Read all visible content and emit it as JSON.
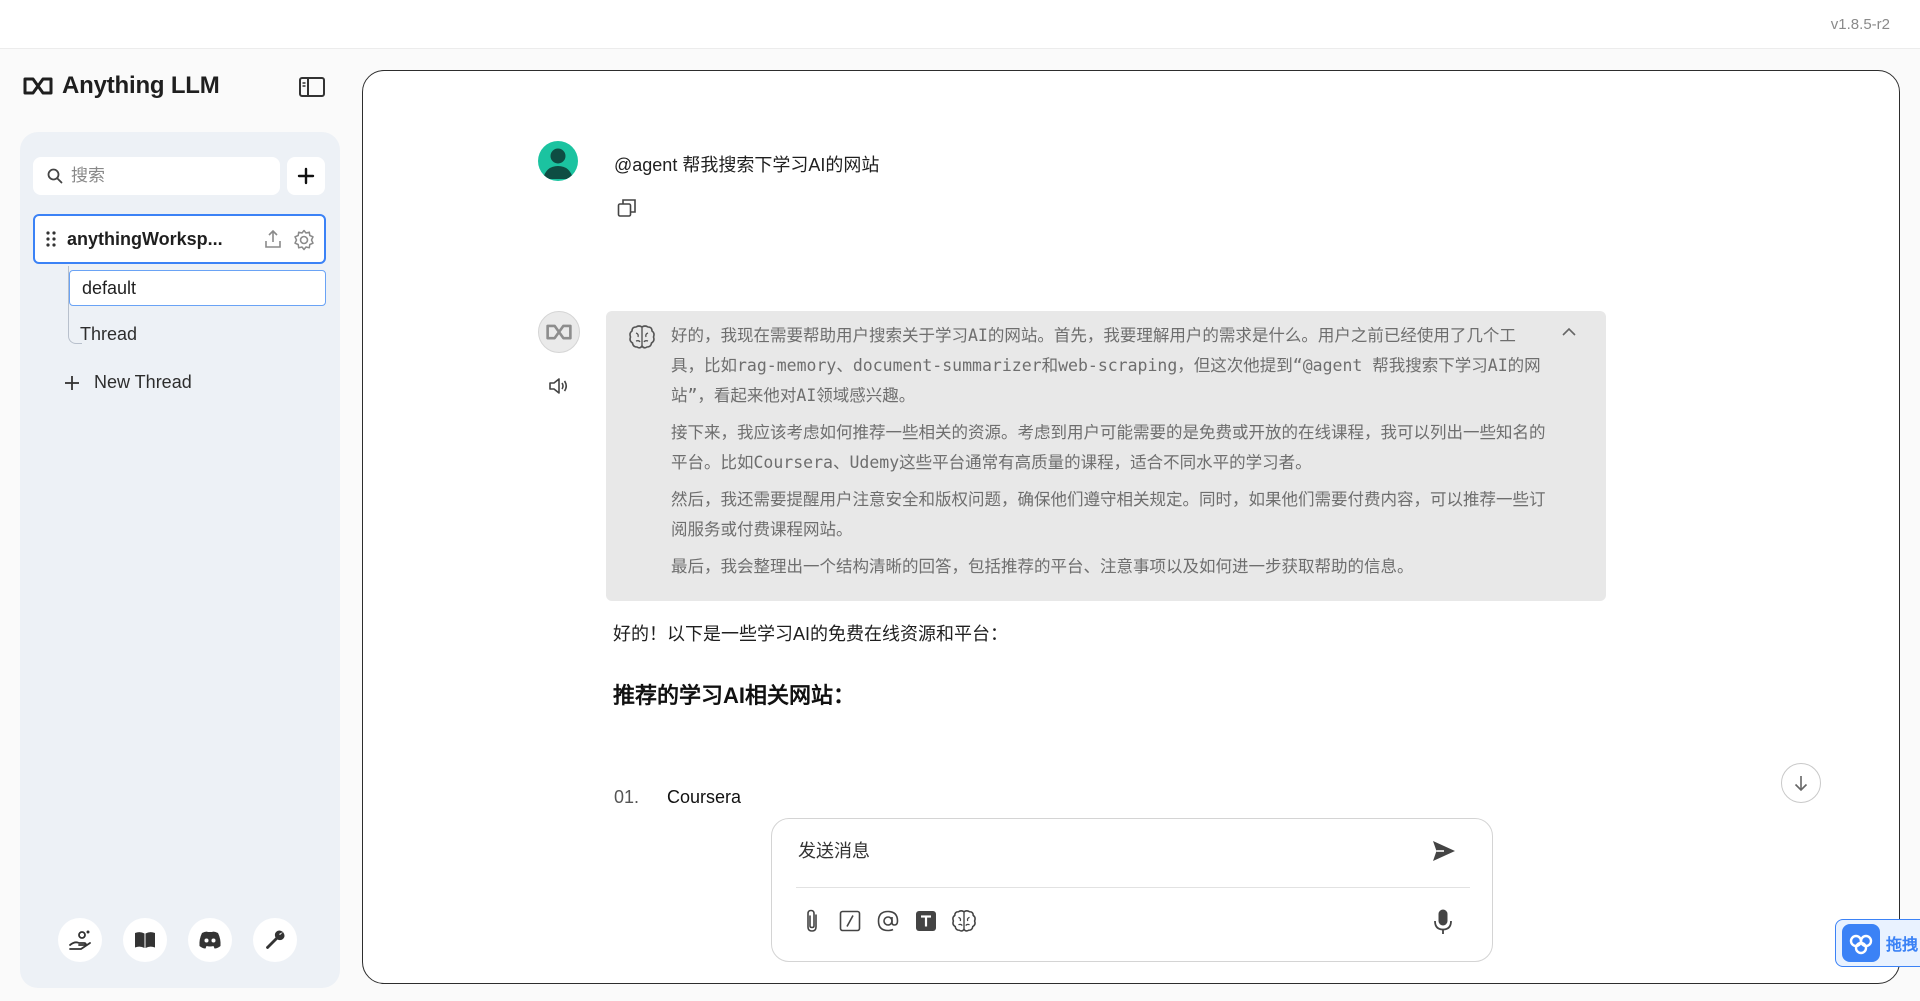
{
  "app": {
    "version": "v1.8.5-r2",
    "brand": "Anything LLM"
  },
  "sidebar": {
    "search_placeholder": "搜索",
    "workspace": {
      "name": "anythingWorksp..."
    },
    "threads": [
      {
        "label": "default",
        "active": true
      },
      {
        "label": "Thread",
        "active": false
      }
    ],
    "new_thread_label": "New Thread",
    "footer_icons": [
      "community-hub-icon",
      "docs-book-icon",
      "discord-icon",
      "settings-wrench-icon"
    ]
  },
  "chat": {
    "user_message": "@agent 帮我搜索下学习AI的网站",
    "thought": [
      "好的，我现在需要帮助用户搜索关于学习AI的网站。首先，我要理解用户的需求是什么。用户之前已经使用了几个工具，比如rag-memory、document-summarizer和web-scraping，但这次他提到“@agent 帮我搜索下学习AI的网站”，看起来他对AI领域感兴趣。",
      "接下来，我应该考虑如何推荐一些相关的资源。考虑到用户可能需要的是免费或开放的在线课程，我可以列出一些知名的平台。比如Coursera、Udemy这些平台通常有高质量的课程，适合不同水平的学习者。",
      "然后，我还需要提醒用户注意安全和版权问题，确保他们遵守相关规定。同时，如果他们需要付费内容，可以推荐一些订阅服务或付费课程网站。",
      "最后，我会整理出一个结构清晰的回答，包括推荐的平台、注意事项以及如何进一步获取帮助的信息。"
    ],
    "answer_intro": "好的！以下是一些学习AI的免费在线资源和平台：",
    "answer_heading": "推荐的学习AI相关网站：",
    "list": [
      {
        "num": "01.",
        "text": "Coursera"
      }
    ]
  },
  "composer": {
    "placeholder": "发送消息"
  },
  "floating": {
    "label": "拖拽"
  },
  "colors": {
    "accent": "#3b82f6",
    "sidebar_bg": "#edf1f6",
    "thought_bg": "#e8e8e8",
    "user_avatar": "#1bc3a0"
  }
}
